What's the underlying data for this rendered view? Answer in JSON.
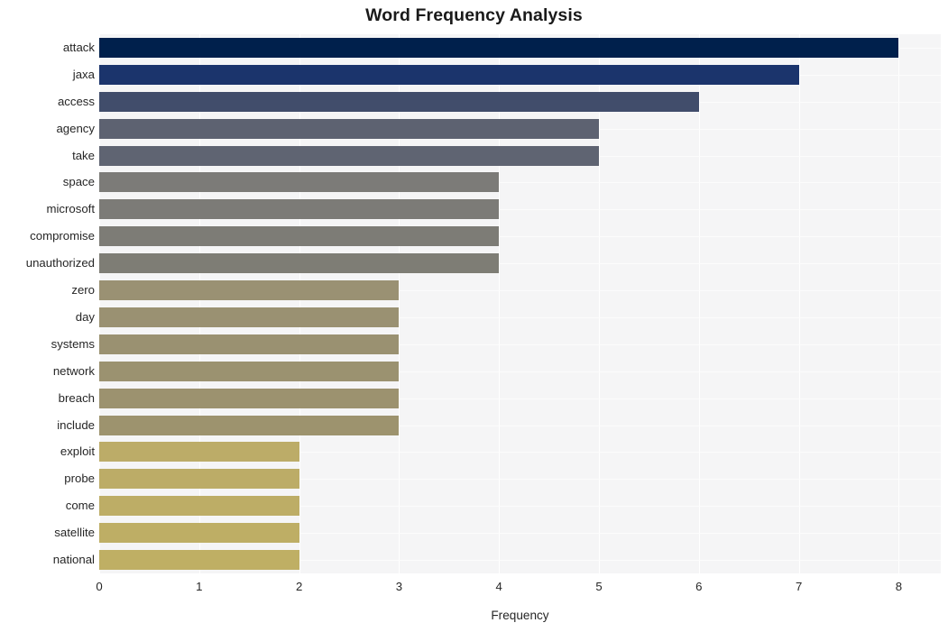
{
  "chart_data": {
    "type": "bar",
    "orientation": "horizontal",
    "title": "Word Frequency Analysis",
    "xlabel": "Frequency",
    "ylabel": "",
    "xlim": [
      0,
      8.42
    ],
    "xticks": [
      0,
      1,
      2,
      3,
      4,
      5,
      6,
      7,
      8
    ],
    "xticklabels": [
      "0",
      "1",
      "2",
      "3",
      "4",
      "5",
      "6",
      "7",
      "8"
    ],
    "grid": true,
    "legend": null,
    "categories": [
      "attack",
      "jaxa",
      "access",
      "agency",
      "take",
      "space",
      "microsoft",
      "compromise",
      "unauthorized",
      "zero",
      "day",
      "systems",
      "network",
      "breach",
      "include",
      "exploit",
      "probe",
      "come",
      "satellite",
      "national"
    ],
    "values": [
      8,
      7,
      6,
      5,
      5,
      4,
      4,
      4,
      4,
      3,
      3,
      3,
      3,
      3,
      3,
      2,
      2,
      2,
      2,
      2
    ],
    "bar_colors": [
      "#00204c",
      "#1b346c",
      "#414d6b",
      "#5d6271",
      "#5f6472",
      "#7c7b78",
      "#7c7b77",
      "#7d7c76",
      "#7e7d75",
      "#9a9173",
      "#9a9172",
      "#9a9171",
      "#9b9270",
      "#9c926f",
      "#9d936e",
      "#bcac68",
      "#bcac67",
      "#bdad66",
      "#beae65",
      "#bfaf64"
    ],
    "plot_background": "#f5f5f6",
    "gridline_color": "#ffffff",
    "figure_background": "#ffffff"
  }
}
